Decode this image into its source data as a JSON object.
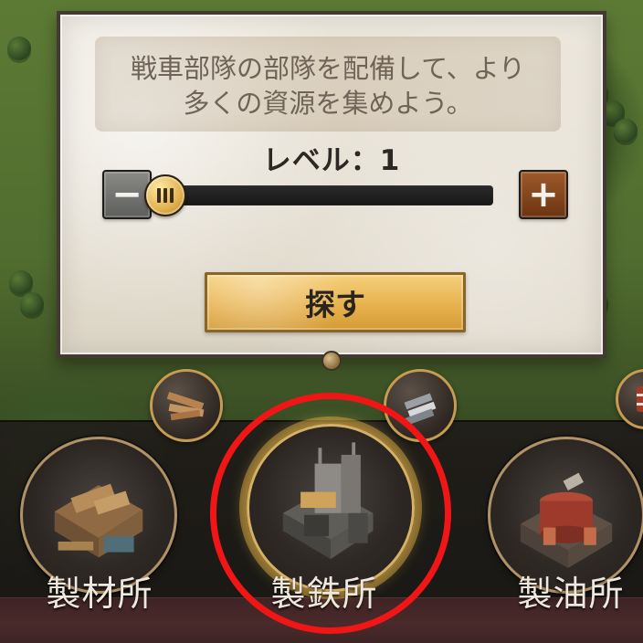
{
  "dialog": {
    "description": "戦車部隊の部隊を配備して、より\n多くの資源を集めよう。",
    "level_text": "レベル：1",
    "level_fraction": 0.02,
    "minus_label": "−",
    "plus_label": "+",
    "search_label": "探す"
  },
  "buildings": [
    {
      "label": "製材所"
    },
    {
      "label": "製鉄所"
    },
    {
      "label": "製油所"
    }
  ],
  "colors": {
    "highlight": "#f01616",
    "search_button": "#e7b24e",
    "plus_button": "#8a4b24"
  }
}
